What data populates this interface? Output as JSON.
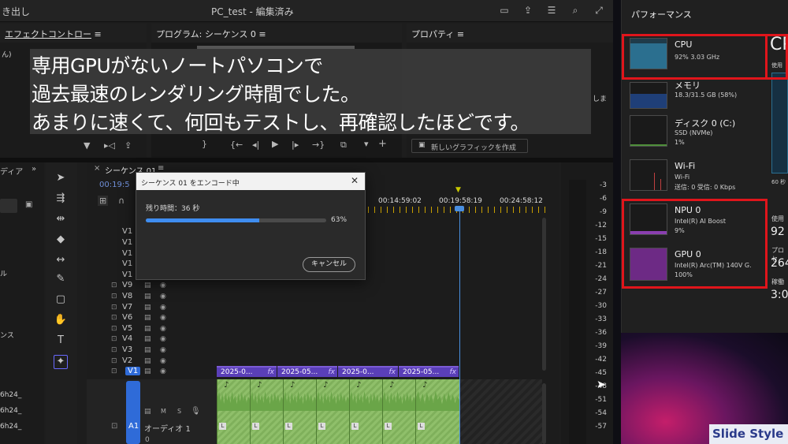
{
  "topbar": {
    "left_label": "き出し",
    "project_title": "PC_test - 編集済み"
  },
  "panels": {
    "effect_controls": "エフェクトコントロー",
    "program": "プログラム: シーケンス 0",
    "properties": "プロパティ",
    "left_snip": "ん)",
    "right_snip": "しま",
    "new_graphic_button": "新しいグラフィックを作成",
    "media_tab": "ディア",
    "sequence_tab": "シーケンス 01",
    "timecode": "00:19:5",
    "ruler_marks": [
      "00:14:59:02",
      "00:19:58:19",
      "00:24:58:12"
    ]
  },
  "caption": {
    "line1": "専用GPUがないノートパソコンで",
    "line2": "過去最速のレンダリング時間でした。",
    "line3": "あまりに速くて、何回もテストし、再確認したほどです。"
  },
  "left_list": [
    "ル",
    "ンス",
    "6h24_",
    "6h24_",
    "6h24_"
  ],
  "timeline": {
    "video_tracks": [
      "V1",
      "V1",
      "V1",
      "V1",
      "V1",
      "V9",
      "V8",
      "V7",
      "V6",
      "V5",
      "V4",
      "V3",
      "V2",
      "V1"
    ],
    "audio_track": "A1",
    "audio_name": "オーディオ 1",
    "audio_mute": "M",
    "audio_solo": "S",
    "audio_vol": "0",
    "clips": [
      "2025-0...",
      "2025-05...",
      "2025-0...",
      "2025-05...",
      "2025-0..."
    ],
    "fx_label": "fx"
  },
  "dialog": {
    "title": "シーケンス 01 をエンコード中",
    "remaining": "残り時間：36 秒",
    "progress": 0.63,
    "percent": "63%",
    "cancel": "キャンセル"
  },
  "meter": {
    "ticks": [
      "-3",
      "-6",
      "-9",
      "-12",
      "-15",
      "-18",
      "-21",
      "-24",
      "-27",
      "-30",
      "-33",
      "-36",
      "-39",
      "-42",
      "-45",
      "-48",
      "-51",
      "-54",
      "-57"
    ]
  },
  "task_manager": {
    "title": "パフォーマンス",
    "items": [
      {
        "name": "CPU",
        "sub1": "92%  3.03 GHz",
        "sub2": ""
      },
      {
        "name": "メモリ",
        "sub1": "18.3/31.5 GB (58%)",
        "sub2": ""
      },
      {
        "name": "ディスク 0 (C:)",
        "sub1": "SSD (NVMe)",
        "sub2": "1%"
      },
      {
        "name": "Wi-Fi",
        "sub1": "Wi-Fi",
        "sub2": "送信: 0  受信: 0 Kbps"
      },
      {
        "name": "NPU 0",
        "sub1": "Intel(R) AI Boost",
        "sub2": "9%"
      },
      {
        "name": "GPU 0",
        "sub1": "Intel(R) Arc(TM) 140V G.",
        "sub2": "100%"
      }
    ],
    "right_heading": "CP",
    "right_snips": [
      "使用",
      "60 秒",
      "使用",
      "92",
      "プロセ",
      "264",
      "稼働",
      "3:0"
    ]
  },
  "watermark": "Slide Style",
  "colors": {
    "accent_blue": "#3f8df0",
    "clip_purple": "#5a3fb8",
    "clip_green": "#8fbf6a",
    "highlight_red": "#e0151b",
    "playhead_blue": "#4a8fe0"
  }
}
